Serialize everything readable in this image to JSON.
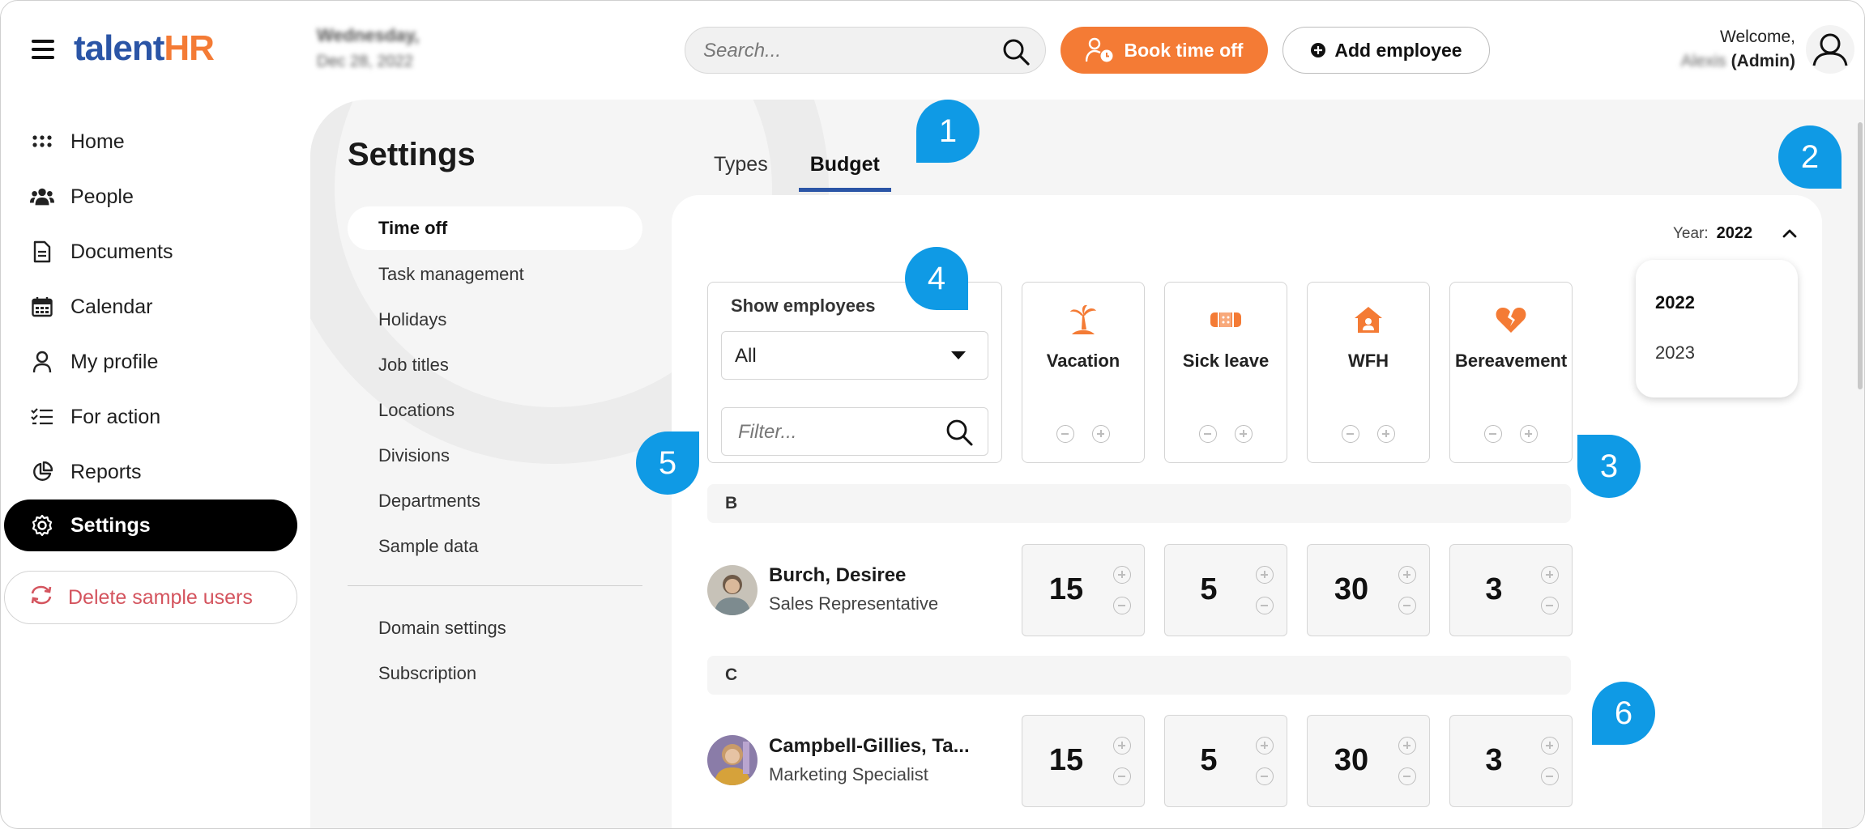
{
  "app": {
    "logo_part1": "talent",
    "logo_part2": "HR",
    "date_line1": "Wednesday,",
    "date_line2": "Dec 28, 2022",
    "search_placeholder": "Search...",
    "book_time_off": "Book time off",
    "add_employee": "Add employee",
    "welcome_label": "Welcome,",
    "user_name": "Alexis",
    "user_role": "(Admin)"
  },
  "nav": {
    "items": [
      {
        "label": "Home",
        "icon": "grid-icon"
      },
      {
        "label": "People",
        "icon": "people-icon"
      },
      {
        "label": "Documents",
        "icon": "document-icon"
      },
      {
        "label": "Calendar",
        "icon": "calendar-icon"
      },
      {
        "label": "My profile",
        "icon": "user-icon"
      },
      {
        "label": "For action",
        "icon": "checklist-icon"
      },
      {
        "label": "Reports",
        "icon": "pie-chart-icon"
      },
      {
        "label": "Settings",
        "icon": "gear-icon"
      }
    ],
    "delete_sample_users": "Delete sample users"
  },
  "settings": {
    "title": "Settings",
    "sub_items": [
      "Time off",
      "Task management",
      "Holidays",
      "Job titles",
      "Locations",
      "Divisions",
      "Departments",
      "Sample data"
    ],
    "sub_items_extra": [
      "Domain settings",
      "Subscription"
    ],
    "tabs": [
      "Types",
      "Budget"
    ],
    "active_tab": "Budget"
  },
  "budget": {
    "year_label": "Year:",
    "year_value": "2022",
    "year_options": [
      "2022",
      "2023"
    ],
    "show_employees_label": "Show employees",
    "show_employees_value": "All",
    "filter_placeholder": "Filter...",
    "types": [
      {
        "name": "Vacation",
        "icon": "palm-tree-icon",
        "color": "#f47b35"
      },
      {
        "name": "Sick leave",
        "icon": "bandage-icon",
        "color": "#f47b35"
      },
      {
        "name": "WFH",
        "icon": "house-icon",
        "color": "#f47b35"
      },
      {
        "name": "Bereavement",
        "icon": "broken-heart-icon",
        "color": "#f47b35"
      }
    ],
    "groups": [
      {
        "letter": "B",
        "employees": [
          {
            "name": "Burch, Desiree",
            "title": "Sales Representative",
            "values": [
              "15",
              "5",
              "30",
              "3"
            ]
          }
        ]
      },
      {
        "letter": "C",
        "employees": [
          {
            "name": "Campbell-Gillies, Ta...",
            "title": "Marketing Specialist",
            "values": [
              "15",
              "5",
              "30",
              "3"
            ]
          }
        ]
      }
    ]
  },
  "callouts": [
    "1",
    "2",
    "3",
    "4",
    "5",
    "6"
  ],
  "colors": {
    "brand_blue": "#2b55a6",
    "brand_orange": "#f47b35",
    "callout_blue": "#0f9ae5",
    "delete_red": "#d4545e"
  }
}
